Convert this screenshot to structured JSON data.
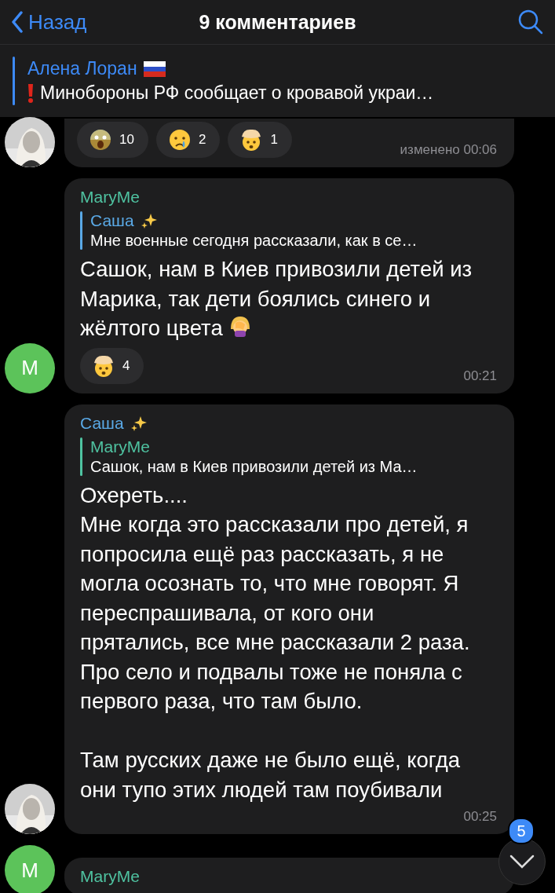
{
  "header": {
    "back": "Назад",
    "title": "9 комментариев"
  },
  "pinned": {
    "author": "Алена Лоран",
    "text": "Минобороны РФ сообщает о кровавой украи…"
  },
  "messages": [
    {
      "avatar": {
        "kind": "picture"
      },
      "reactions": [
        {
          "kind": "scream",
          "count": "10"
        },
        {
          "kind": "cry",
          "count": "2"
        },
        {
          "kind": "exploding",
          "count": "1"
        }
      ],
      "time": "изменено 00:06"
    },
    {
      "author": "MaryMe",
      "color": "#4fc3a1",
      "avatar": {
        "kind": "letter",
        "letter": "M"
      },
      "reply": {
        "author": "Саша",
        "sparkles": true,
        "color": "#5aa9e6",
        "text": "Мне военные сегодня рассказали, как в се…"
      },
      "text": "Сашок, нам в Киев привозили детей из Марика, так дети боялись синего и жёлтого цвета",
      "facepalm": true,
      "reactions": [
        {
          "kind": "exploding",
          "count": "4"
        }
      ],
      "time": "00:21"
    },
    {
      "author": "Саша",
      "sparkles": true,
      "color": "#5aa9e6",
      "avatar": {
        "kind": "picture"
      },
      "reply": {
        "author": "MaryMe",
        "color": "#4fc3a1",
        "text": "Сашок, нам в Киев привозили детей из Ма…"
      },
      "text": "Охереть....\nМне когда это рассказали про детей, я попросила ещё раз рассказать, я не могла осознать то, что мне говорят. Я переспрашивала, от кого они прятались, все мне рассказали 2 раза. Про село и подвалы тоже не поняла с первого раза, что там было.\n\nТам русских даже не было ещё, когда они тупо этих людей там поубивали",
      "time": "00:25"
    },
    {
      "author": "MaryMe",
      "color": "#4fc3a1",
      "avatar": {
        "kind": "letter",
        "letter": "M"
      }
    }
  ],
  "scroll_button": {
    "badge": "5"
  }
}
